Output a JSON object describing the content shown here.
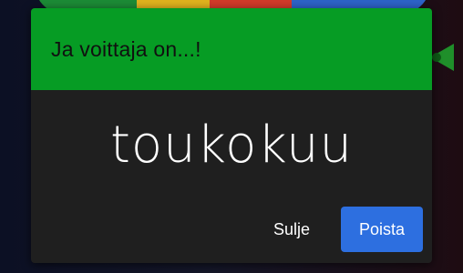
{
  "dialog": {
    "title": "Ja voittaja on...!",
    "winner": "toukokuu",
    "close_label": "Sulje",
    "remove_label": "Poista"
  },
  "colors": {
    "header_green": "#069c24",
    "dialog_bg": "#1f1f1f",
    "primary_blue": "#2d6fe0",
    "pointer_green": "#1f8f2a"
  },
  "icons": {
    "pointer": "wheel-pointer-icon"
  }
}
